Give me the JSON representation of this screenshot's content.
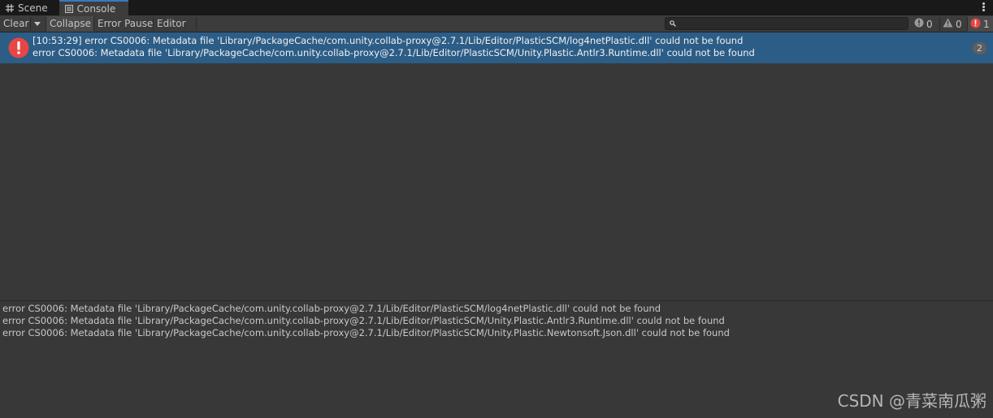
{
  "tabs": [
    {
      "label": "Scene",
      "icon": "grid-icon"
    },
    {
      "label": "Console",
      "icon": "console-icon"
    }
  ],
  "toolbar": {
    "clear_label": "Clear",
    "collapse_label": "Collapse",
    "error_pause_label": "Error Pause",
    "editor_label": "Editor",
    "search_placeholder": ""
  },
  "counters": {
    "info": "0",
    "warning": "0",
    "error": "1"
  },
  "log_entries": [
    {
      "line1": "[10:53:29] error CS0006: Metadata file 'Library/PackageCache/com.unity.collab-proxy@2.7.1/Lib/Editor/PlasticSCM/log4netPlastic.dll' could not be found",
      "line2": "error CS0006: Metadata file 'Library/PackageCache/com.unity.collab-proxy@2.7.1/Lib/Editor/PlasticSCM/Unity.Plastic.Antlr3.Runtime.dll' could not be found",
      "count": "2",
      "level": "error"
    }
  ],
  "details": [
    "error CS0006: Metadata file 'Library/PackageCache/com.unity.collab-proxy@2.7.1/Lib/Editor/PlasticSCM/log4netPlastic.dll' could not be found",
    "error CS0006: Metadata file 'Library/PackageCache/com.unity.collab-proxy@2.7.1/Lib/Editor/PlasticSCM/Unity.Plastic.Antlr3.Runtime.dll' could not be found",
    "error CS0006: Metadata file 'Library/PackageCache/com.unity.collab-proxy@2.7.1/Lib/Editor/PlasticSCM/Unity.Plastic.Newtonsoft.Json.dll' could not be found"
  ],
  "watermark": "CSDN @青菜南瓜粥",
  "colors": {
    "selected_row": "#2c5d87",
    "error_red": "#e84545",
    "active_tab_accent": "#3a79bb"
  }
}
